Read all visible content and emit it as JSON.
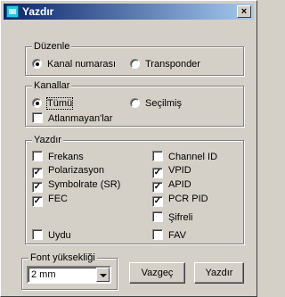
{
  "window": {
    "title": "Yazdır",
    "close_label": "×"
  },
  "duzenle": {
    "legend": "Düzenle",
    "options": [
      {
        "label": "Kanal numarası",
        "selected": true
      },
      {
        "label": "Transponder",
        "selected": false
      }
    ]
  },
  "kanallar": {
    "legend": "Kanallar",
    "options": [
      {
        "label": "Tümü",
        "selected": true
      },
      {
        "label": "Seçilmiş",
        "selected": false
      }
    ],
    "skip_checkbox": {
      "label": "Atlanmayan'lar",
      "checked": false
    }
  },
  "yazdir": {
    "legend": "Yazdır",
    "left": [
      {
        "label": "Frekans",
        "checked": false
      },
      {
        "label": "Polarizasyon",
        "checked": true
      },
      {
        "label": "Symbolrate (SR)",
        "checked": true
      },
      {
        "label": "FEC",
        "checked": true
      },
      {
        "label": "Uydu",
        "checked": false
      }
    ],
    "right": [
      {
        "label": "Channel ID",
        "checked": false
      },
      {
        "label": "VPID",
        "checked": true
      },
      {
        "label": "APID",
        "checked": true
      },
      {
        "label": "PCR PID",
        "checked": true
      },
      {
        "label": "Şifreli",
        "checked": false
      },
      {
        "label": "FAV",
        "checked": false
      }
    ]
  },
  "font": {
    "legend": "Font yüksekliği",
    "selected_value": "2 mm"
  },
  "buttons": {
    "cancel": "Vazgeç",
    "print": "Yazdır"
  }
}
